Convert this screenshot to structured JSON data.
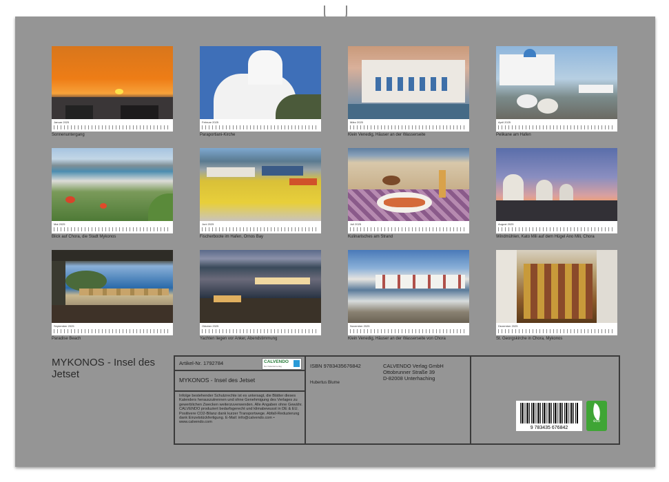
{
  "calendar": {
    "months": [
      {
        "month": "Januar 2025",
        "caption": "Sonnenuntergang"
      },
      {
        "month": "Februar 2025",
        "caption": "Paraportiani-Kirche"
      },
      {
        "month": "März 2025",
        "caption": "Klein Venedig, Häuser an der Wasserseite"
      },
      {
        "month": "April 2025",
        "caption": "Pelikane am Hafen"
      },
      {
        "month": "Mai 2025",
        "caption": "Blick auf Chora, die Stadt Mykonos"
      },
      {
        "month": "Juni 2025",
        "caption": "Fischerboote im Hafen, Ornos Bay"
      },
      {
        "month": "Juli 2025",
        "caption": "Kulinarisches am Strand"
      },
      {
        "month": "August 2025",
        "caption": "Windmühlen, Kato Mili auf dem Hügel Ano Mili, Chora"
      },
      {
        "month": "September 2025",
        "caption": "Paradise Beach"
      },
      {
        "month": "Oktober 2025",
        "caption": "Yachten liegen vor Anker, Abendstimmung"
      },
      {
        "month": "November 2025",
        "caption": "Klein Venedig, Häuser an der Wasserseite von Chora"
      },
      {
        "month": "Dezember 2025",
        "caption": "St. Georgskirche in Chora, Mykonos"
      }
    ]
  },
  "backcover": {
    "title": "MYKONOS - Insel des Jetset",
    "article": "Artikel-Nr. 1792784",
    "logo_name": "CALVENDO",
    "logo_sub": "Der Kalenderverlag",
    "product_title": "MYKONOS - Insel des Jetset",
    "isbn": "ISBN 9783435676842",
    "author": "Hubertus Blume",
    "publisher": [
      "CALVENDO Verlag GmbH",
      "Ottobrunner Straße 39",
      "D-82008 Unterhaching"
    ],
    "legal": "Infolge bestehender Schutzrechte ist es untersagt, die Blätter dieses Kalenders herauszutrennen und ohne Genehmigung des Verlages zu gewerblichen Zwecken weiterzuverwenden. Alle Angaben ohne Gewähr. CALVENDO produziert bedarfsgerecht und klimabewusst in DE & EU. Positivere CO2-Bilanz dank kurzer Transportwege. Abfall-Reduzierung dank Einzelstückfertigung. E-Mail: info@calvendo.com • www.calvendo.com",
    "barcode_number": "9 783435 676842",
    "eco_label": "eco"
  }
}
